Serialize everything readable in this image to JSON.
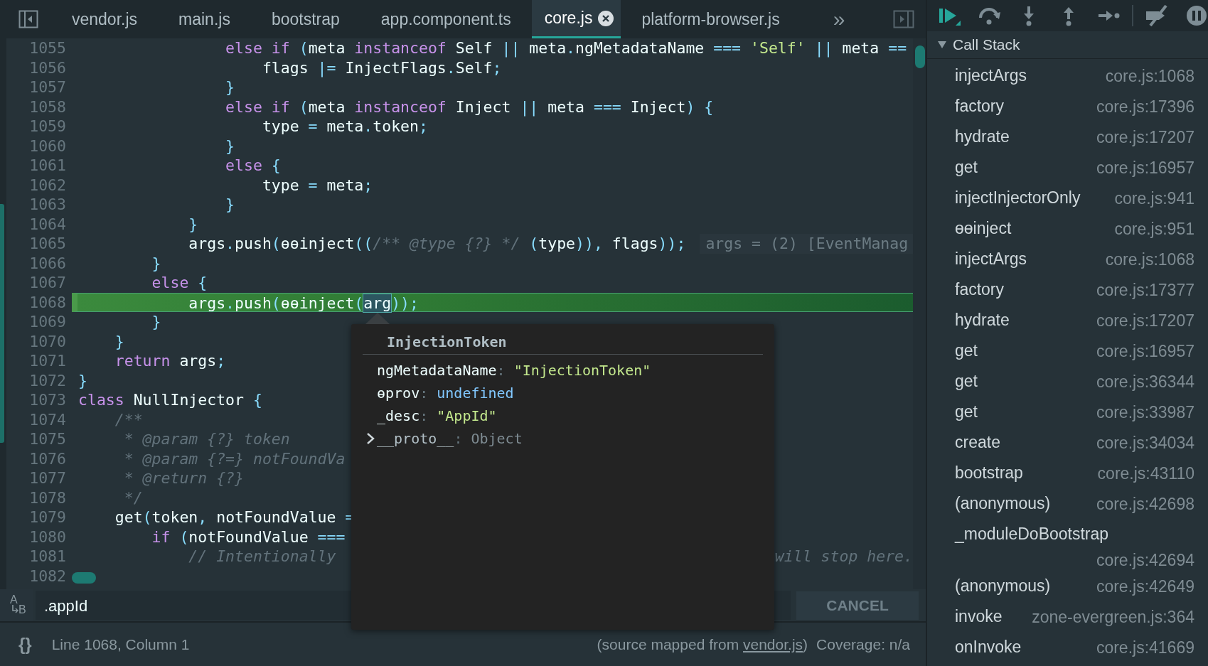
{
  "tabs": [
    {
      "label": "vendor.js",
      "selected": false
    },
    {
      "label": "main.js",
      "selected": false
    },
    {
      "label": "bootstrap",
      "selected": false
    },
    {
      "label": "app.component.ts",
      "selected": false
    },
    {
      "label": "core.js",
      "selected": true
    },
    {
      "label": "platform-browser.js",
      "selected": false
    }
  ],
  "tab_overflow": "»",
  "code_lines": [
    {
      "number": "1055",
      "highlighted": false,
      "tokens": [
        {
          "kind": "kw",
          "text": "                else if "
        },
        {
          "kind": "p",
          "text": "("
        },
        {
          "kind": "id",
          "text": "meta "
        },
        {
          "kind": "kw",
          "text": "instanceof"
        },
        {
          "kind": "id",
          "text": " Self "
        },
        {
          "kind": "p",
          "text": "||"
        },
        {
          "kind": "id",
          "text": " meta"
        },
        {
          "kind": "p",
          "text": "."
        },
        {
          "kind": "id",
          "text": "ngMetadataName "
        },
        {
          "kind": "p",
          "text": "=== "
        },
        {
          "kind": "str",
          "text": "'Self'"
        },
        {
          "kind": "p",
          "text": " ||"
        },
        {
          "kind": "id",
          "text": " meta "
        },
        {
          "kind": "p",
          "text": "=="
        }
      ]
    },
    {
      "number": "1056",
      "highlighted": false,
      "tokens": [
        {
          "kind": "id",
          "text": "                    flags "
        },
        {
          "kind": "p",
          "text": "|="
        },
        {
          "kind": "id",
          "text": " InjectFlags"
        },
        {
          "kind": "p",
          "text": "."
        },
        {
          "kind": "id",
          "text": "Self"
        },
        {
          "kind": "p",
          "text": ";"
        }
      ]
    },
    {
      "number": "1057",
      "highlighted": false,
      "tokens": [
        {
          "kind": "p",
          "text": "                }"
        }
      ]
    },
    {
      "number": "1058",
      "highlighted": false,
      "tokens": [
        {
          "kind": "kw",
          "text": "                else if "
        },
        {
          "kind": "p",
          "text": "("
        },
        {
          "kind": "id",
          "text": "meta "
        },
        {
          "kind": "kw",
          "text": "instanceof"
        },
        {
          "kind": "id",
          "text": " Inject "
        },
        {
          "kind": "p",
          "text": "||"
        },
        {
          "kind": "id",
          "text": " meta "
        },
        {
          "kind": "p",
          "text": "==="
        },
        {
          "kind": "id",
          "text": " Inject"
        },
        {
          "kind": "p",
          "text": ") {"
        }
      ]
    },
    {
      "number": "1059",
      "highlighted": false,
      "tokens": [
        {
          "kind": "id",
          "text": "                    type "
        },
        {
          "kind": "p",
          "text": "="
        },
        {
          "kind": "id",
          "text": " meta"
        },
        {
          "kind": "p",
          "text": "."
        },
        {
          "kind": "id",
          "text": "token"
        },
        {
          "kind": "p",
          "text": ";"
        }
      ]
    },
    {
      "number": "1060",
      "highlighted": false,
      "tokens": [
        {
          "kind": "p",
          "text": "                }"
        }
      ]
    },
    {
      "number": "1061",
      "highlighted": false,
      "tokens": [
        {
          "kind": "kw",
          "text": "                else "
        },
        {
          "kind": "p",
          "text": "{"
        }
      ]
    },
    {
      "number": "1062",
      "highlighted": false,
      "tokens": [
        {
          "kind": "id",
          "text": "                    type "
        },
        {
          "kind": "p",
          "text": "="
        },
        {
          "kind": "id",
          "text": " meta"
        },
        {
          "kind": "p",
          "text": ";"
        }
      ]
    },
    {
      "number": "1063",
      "highlighted": false,
      "tokens": [
        {
          "kind": "p",
          "text": "                }"
        }
      ]
    },
    {
      "number": "1064",
      "highlighted": false,
      "tokens": [
        {
          "kind": "p",
          "text": "            }"
        }
      ]
    },
    {
      "number": "1065",
      "highlighted": false,
      "tokens": [
        {
          "kind": "id",
          "text": "            args"
        },
        {
          "kind": "p",
          "text": "."
        },
        {
          "kind": "id",
          "text": "push"
        },
        {
          "kind": "p",
          "text": "("
        },
        {
          "kind": "id",
          "text": "ɵɵinject"
        },
        {
          "kind": "p",
          "text": "(("
        },
        {
          "kind": "cmt",
          "text": "/** @type {?} */"
        },
        {
          "kind": "p",
          "text": " ("
        },
        {
          "kind": "id",
          "text": "type"
        },
        {
          "kind": "p",
          "text": ")),"
        },
        {
          "kind": "id",
          "text": " flags"
        },
        {
          "kind": "p",
          "text": "));"
        }
      ],
      "inline_value": "args = (2) [EventManag"
    },
    {
      "number": "1066",
      "highlighted": false,
      "tokens": [
        {
          "kind": "p",
          "text": "        }"
        }
      ]
    },
    {
      "number": "1067",
      "highlighted": false,
      "tokens": [
        {
          "kind": "kw",
          "text": "        else "
        },
        {
          "kind": "p",
          "text": "{"
        }
      ]
    },
    {
      "number": "1068",
      "highlighted": true,
      "tokens": [
        {
          "kind": "id",
          "text": "            args"
        },
        {
          "kind": "p",
          "text": "."
        },
        {
          "kind": "id",
          "text": "push"
        },
        {
          "kind": "p",
          "text": "("
        },
        {
          "kind": "id",
          "text": "ɵɵinject"
        },
        {
          "kind": "p",
          "text": "("
        },
        {
          "kind": "hover",
          "text": "arg"
        },
        {
          "kind": "p",
          "text": "));"
        }
      ]
    },
    {
      "number": "1069",
      "highlighted": false,
      "tokens": [
        {
          "kind": "p",
          "text": "        }"
        }
      ]
    },
    {
      "number": "1070",
      "highlighted": false,
      "tokens": [
        {
          "kind": "p",
          "text": "    }"
        }
      ]
    },
    {
      "number": "1071",
      "highlighted": false,
      "tokens": [
        {
          "kind": "kw",
          "text": "    return"
        },
        {
          "kind": "id",
          "text": " args"
        },
        {
          "kind": "p",
          "text": ";"
        }
      ]
    },
    {
      "number": "1072",
      "highlighted": false,
      "tokens": [
        {
          "kind": "p",
          "text": "}"
        }
      ]
    },
    {
      "number": "1073",
      "highlighted": false,
      "tokens": [
        {
          "kind": "kw",
          "text": "class"
        },
        {
          "kind": "id",
          "text": " NullInjector "
        },
        {
          "kind": "p",
          "text": "{"
        }
      ]
    },
    {
      "number": "1074",
      "highlighted": false,
      "tokens": [
        {
          "kind": "cmt",
          "text": "    /**"
        }
      ]
    },
    {
      "number": "1075",
      "highlighted": false,
      "tokens": [
        {
          "kind": "cmt",
          "text": "     * @param {?} token"
        }
      ]
    },
    {
      "number": "1076",
      "highlighted": false,
      "tokens": [
        {
          "kind": "cmt",
          "text": "     * @param {?=} notFoundVa"
        }
      ]
    },
    {
      "number": "1077",
      "highlighted": false,
      "tokens": [
        {
          "kind": "cmt",
          "text": "     * @return {?}"
        }
      ]
    },
    {
      "number": "1078",
      "highlighted": false,
      "tokens": [
        {
          "kind": "cmt",
          "text": "     */"
        }
      ]
    },
    {
      "number": "1079",
      "highlighted": false,
      "tokens": [
        {
          "kind": "id",
          "text": "    get"
        },
        {
          "kind": "p",
          "text": "("
        },
        {
          "kind": "id",
          "text": "token"
        },
        {
          "kind": "p",
          "text": ","
        },
        {
          "kind": "id",
          "text": " notFoundValue "
        },
        {
          "kind": "p",
          "text": "="
        }
      ]
    },
    {
      "number": "1080",
      "highlighted": false,
      "tokens": [
        {
          "kind": "kw",
          "text": "        if "
        },
        {
          "kind": "p",
          "text": "("
        },
        {
          "kind": "id",
          "text": "notFoundValue "
        },
        {
          "kind": "p",
          "text": "==="
        }
      ]
    },
    {
      "number": "1081",
      "highlighted": false,
      "tokens": [
        {
          "kind": "cmt",
          "text": "            // Intentionally"
        }
      ],
      "trailing": "will stop here."
    },
    {
      "number": "1082",
      "highlighted": false
    }
  ],
  "popover": {
    "title": "InjectionToken",
    "separator": ":",
    "properties": [
      {
        "name": "ngMetadataName",
        "value": "\"InjectionToken\"",
        "kind": "string"
      },
      {
        "name": "ɵprov",
        "value": "undefined",
        "kind": "undefined"
      },
      {
        "name": "_desc",
        "value": "\"AppId\"",
        "kind": "string"
      },
      {
        "name": "__proto__",
        "value": "Object",
        "kind": "object",
        "expanded": false
      }
    ]
  },
  "search_bar": {
    "toggle_letters": [
      "A",
      "B"
    ],
    "value": ".appId",
    "cancel_label": "CANCEL"
  },
  "status_bar": {
    "format_label": "{}",
    "position": "Line 1068, Column 1",
    "source_prefix": "(source mapped from ",
    "source_link": "vendor.js",
    "source_suffix": ")",
    "coverage": "Coverage: n/a"
  },
  "call_stack": {
    "title": "Call Stack",
    "expanded": true,
    "frames": [
      {
        "function": "injectArgs",
        "location": "core.js:1068"
      },
      {
        "function": "factory",
        "location": "core.js:17396"
      },
      {
        "function": "hydrate",
        "location": "core.js:17207"
      },
      {
        "function": "get",
        "location": "core.js:16957"
      },
      {
        "function": "injectInjectorOnly",
        "location": "core.js:941"
      },
      {
        "function": "ɵɵinject",
        "location": "core.js:951"
      },
      {
        "function": "injectArgs",
        "location": "core.js:1068"
      },
      {
        "function": "factory",
        "location": "core.js:17377"
      },
      {
        "function": "hydrate",
        "location": "core.js:17207"
      },
      {
        "function": "get",
        "location": "core.js:16957"
      },
      {
        "function": "get",
        "location": "core.js:36344"
      },
      {
        "function": "get",
        "location": "core.js:33987"
      },
      {
        "function": "create",
        "location": "core.js:34034"
      },
      {
        "function": "bootstrap",
        "location": "core.js:43110"
      },
      {
        "function": "(anonymous)",
        "location": "core.js:42698"
      },
      {
        "function": "_moduleDoBootstrap",
        "location": "core.js:42694"
      },
      {
        "function": "(anonymous)",
        "location": "core.js:42649"
      },
      {
        "function": "invoke",
        "location": "zone-evergreen.js:364"
      },
      {
        "function": "onInvoke",
        "location": "core.js:41669"
      }
    ]
  }
}
